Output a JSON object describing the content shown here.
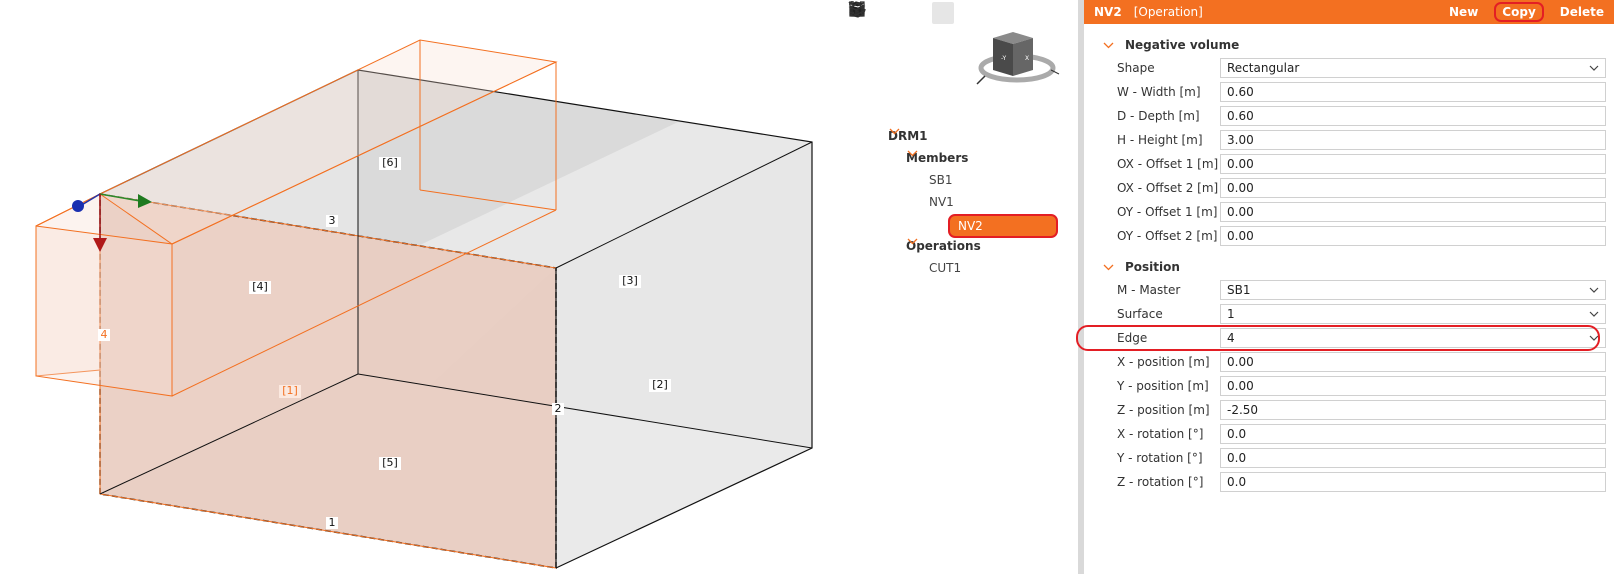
{
  "panel": {
    "header": {
      "name": "NV2",
      "operation": "[Operation]",
      "actions": {
        "new": "New",
        "copy": "Copy",
        "delete": "Delete"
      }
    },
    "negative_volume": {
      "title": "Negative volume",
      "rows": [
        {
          "label": "Shape",
          "value": "Rectangular",
          "dropdown": true
        },
        {
          "label": "W - Width [m]",
          "value": "0.60"
        },
        {
          "label": "D - Depth [m]",
          "value": "0.60"
        },
        {
          "label": "H - Height [m]",
          "value": "3.00"
        },
        {
          "label": "OX - Offset 1 [m]",
          "value": "0.00"
        },
        {
          "label": "OX - Offset 2 [m]",
          "value": "0.00"
        },
        {
          "label": "OY - Offset 1 [m]",
          "value": "0.00"
        },
        {
          "label": "OY - Offset 2 [m]",
          "value": "0.00"
        }
      ]
    },
    "position": {
      "title": "Position",
      "rows": [
        {
          "label": "M - Master",
          "value": "SB1",
          "dropdown": true
        },
        {
          "label": "Surface",
          "value": "1",
          "dropdown": true
        },
        {
          "label": "Edge",
          "value": "4",
          "dropdown": true
        },
        {
          "label": "X - position [m]",
          "value": "0.00"
        },
        {
          "label": "Y - position [m]",
          "value": "0.00"
        },
        {
          "label": "Z - position [m]",
          "value": "-2.50"
        },
        {
          "label": "X - rotation [°]",
          "value": "0.0"
        },
        {
          "label": "Y - rotation [°]",
          "value": "0.0"
        },
        {
          "label": "Z - rotation [°]",
          "value": "0.0"
        }
      ]
    }
  },
  "tree": {
    "root": "DRM1",
    "members_label": "Members",
    "members": [
      "SB1",
      "NV1",
      "NV2"
    ],
    "selected": "NV2",
    "operations_label": "Operations",
    "operations": [
      "CUT1"
    ]
  },
  "toolbar": {
    "icons": [
      "crop-icon",
      "rotate-icon",
      "wireframe-cube-icon",
      "solid-cube-icon",
      "plane-cube-icon",
      "home-icon",
      "fullscreen-icon"
    ]
  },
  "model": {
    "surface_labels": [
      "[6]",
      "[4]",
      "[3]",
      "[2]",
      "[1]",
      "[5]"
    ],
    "edge_labels": [
      "3",
      "4",
      "2",
      "1"
    ]
  },
  "view_cube": {
    "face_y": "-Y",
    "face_x": "X"
  },
  "colors": {
    "accent": "#f37021",
    "highlight_ring": "#e31e24",
    "surface_fill": "#e8c9bc",
    "volume_edge": "#f37021"
  }
}
